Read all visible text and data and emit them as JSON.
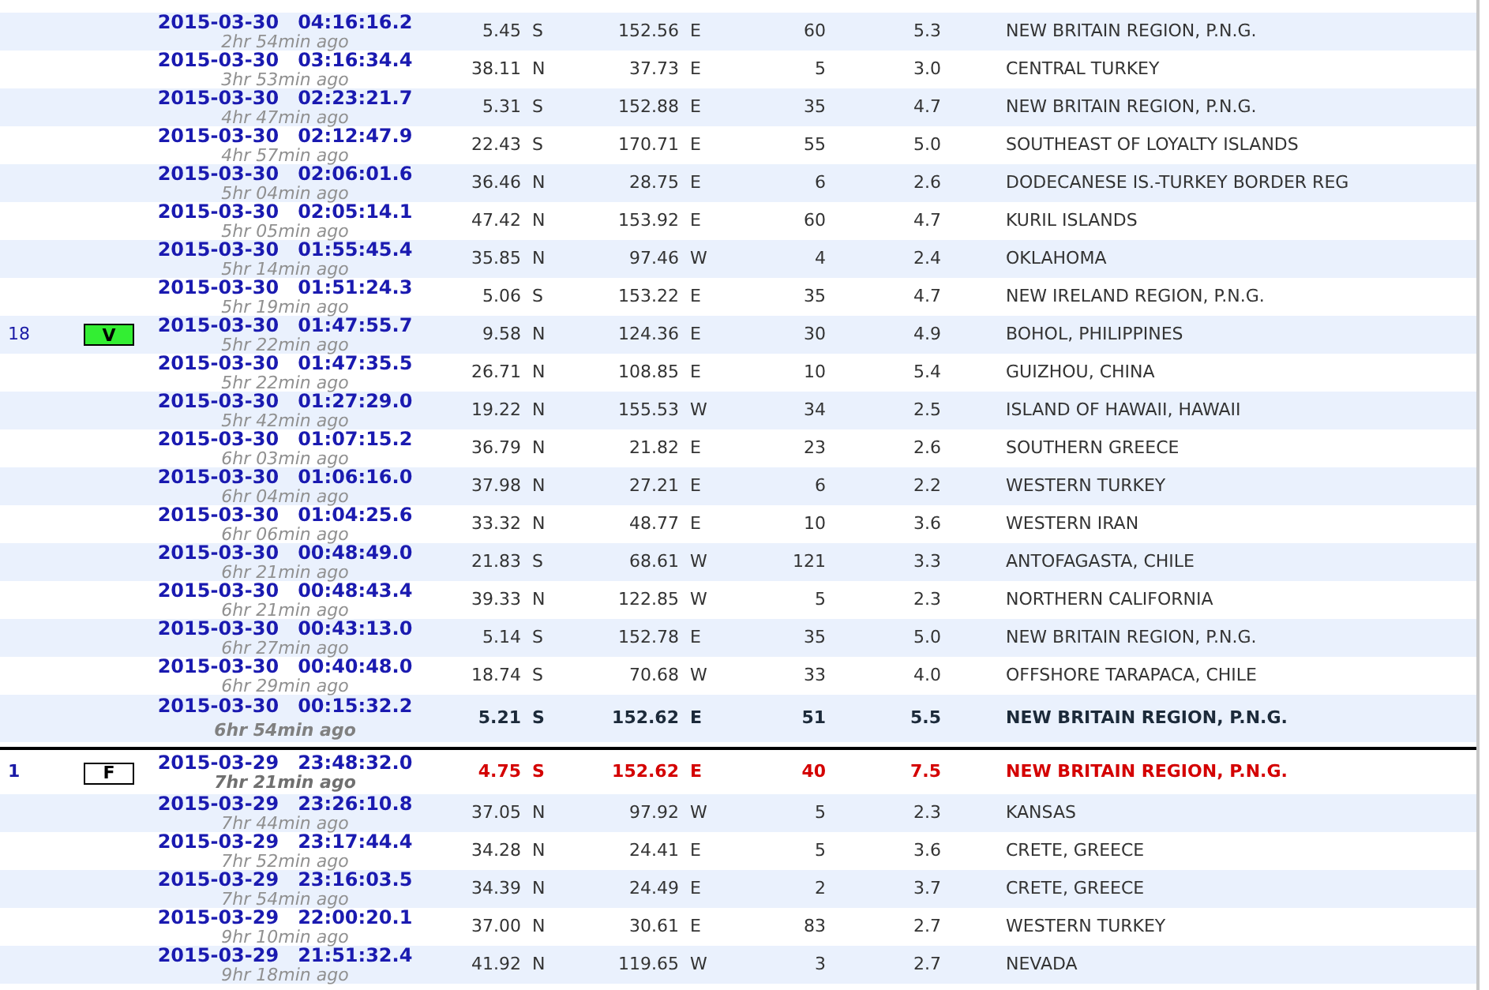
{
  "rows": [
    {
      "kind": "normal",
      "date": "2015-03-30",
      "time": "04:16:16.2",
      "ago": "2hr 54min ago",
      "lat": "5.45",
      "ns": "S",
      "lon": "152.56",
      "ew": "E",
      "depth": "60",
      "mag": "5.3",
      "location": "NEW BRITAIN REGION, P.N.G."
    },
    {
      "kind": "normal",
      "date": "2015-03-30",
      "time": "03:16:34.4",
      "ago": "3hr 53min ago",
      "lat": "38.11",
      "ns": "N",
      "lon": "37.73",
      "ew": "E",
      "depth": "5",
      "mag": "3.0",
      "location": "CENTRAL TURKEY"
    },
    {
      "kind": "normal",
      "date": "2015-03-30",
      "time": "02:23:21.7",
      "ago": "4hr 47min ago",
      "lat": "5.31",
      "ns": "S",
      "lon": "152.88",
      "ew": "E",
      "depth": "35",
      "mag": "4.7",
      "location": "NEW BRITAIN REGION, P.N.G."
    },
    {
      "kind": "normal",
      "date": "2015-03-30",
      "time": "02:12:47.9",
      "ago": "4hr 57min ago",
      "lat": "22.43",
      "ns": "S",
      "lon": "170.71",
      "ew": "E",
      "depth": "55",
      "mag": "5.0",
      "location": "SOUTHEAST OF LOYALTY ISLANDS"
    },
    {
      "kind": "normal",
      "date": "2015-03-30",
      "time": "02:06:01.6",
      "ago": "5hr 04min ago",
      "lat": "36.46",
      "ns": "N",
      "lon": "28.75",
      "ew": "E",
      "depth": "6",
      "mag": "2.6",
      "location": "DODECANESE IS.-TURKEY BORDER REG"
    },
    {
      "kind": "normal",
      "date": "2015-03-30",
      "time": "02:05:14.1",
      "ago": "5hr 05min ago",
      "lat": "47.42",
      "ns": "N",
      "lon": "153.92",
      "ew": "E",
      "depth": "60",
      "mag": "4.7",
      "location": "KURIL ISLANDS"
    },
    {
      "kind": "normal",
      "date": "2015-03-30",
      "time": "01:55:45.4",
      "ago": "5hr 14min ago",
      "lat": "35.85",
      "ns": "N",
      "lon": "97.46",
      "ew": "W",
      "depth": "4",
      "mag": "2.4",
      "location": "OKLAHOMA"
    },
    {
      "kind": "normal",
      "date": "2015-03-30",
      "time": "01:51:24.3",
      "ago": "5hr 19min ago",
      "lat": "5.06",
      "ns": "S",
      "lon": "153.22",
      "ew": "E",
      "depth": "35",
      "mag": "4.7",
      "location": "NEW IRELAND REGION, P.N.G."
    },
    {
      "kind": "normal",
      "count": "18",
      "badge": {
        "kind": "filled",
        "label": "V"
      },
      "date": "2015-03-30",
      "time": "01:47:55.7",
      "ago": "5hr 22min ago",
      "lat": "9.58",
      "ns": "N",
      "lon": "124.36",
      "ew": "E",
      "depth": "30",
      "mag": "4.9",
      "location": "BOHOL, PHILIPPINES"
    },
    {
      "kind": "normal",
      "date": "2015-03-30",
      "time": "01:47:35.5",
      "ago": "5hr 22min ago",
      "lat": "26.71",
      "ns": "N",
      "lon": "108.85",
      "ew": "E",
      "depth": "10",
      "mag": "5.4",
      "location": "GUIZHOU, CHINA"
    },
    {
      "kind": "normal",
      "date": "2015-03-30",
      "time": "01:27:29.0",
      "ago": "5hr 42min ago",
      "lat": "19.22",
      "ns": "N",
      "lon": "155.53",
      "ew": "W",
      "depth": "34",
      "mag": "2.5",
      "location": "ISLAND OF HAWAII, HAWAII"
    },
    {
      "kind": "normal",
      "date": "2015-03-30",
      "time": "01:07:15.2",
      "ago": "6hr 03min ago",
      "lat": "36.79",
      "ns": "N",
      "lon": "21.82",
      "ew": "E",
      "depth": "23",
      "mag": "2.6",
      "location": "SOUTHERN GREECE"
    },
    {
      "kind": "normal",
      "date": "2015-03-30",
      "time": "01:06:16.0",
      "ago": "6hr 04min ago",
      "lat": "37.98",
      "ns": "N",
      "lon": "27.21",
      "ew": "E",
      "depth": "6",
      "mag": "2.2",
      "location": "WESTERN TURKEY"
    },
    {
      "kind": "normal",
      "date": "2015-03-30",
      "time": "01:04:25.6",
      "ago": "6hr 06min ago",
      "lat": "33.32",
      "ns": "N",
      "lon": "48.77",
      "ew": "E",
      "depth": "10",
      "mag": "3.6",
      "location": "WESTERN IRAN"
    },
    {
      "kind": "normal",
      "date": "2015-03-30",
      "time": "00:48:49.0",
      "ago": "6hr 21min ago",
      "lat": "21.83",
      "ns": "S",
      "lon": "68.61",
      "ew": "W",
      "depth": "121",
      "mag": "3.3",
      "location": "ANTOFAGASTA, CHILE"
    },
    {
      "kind": "normal",
      "date": "2015-03-30",
      "time": "00:48:43.4",
      "ago": "6hr 21min ago",
      "lat": "39.33",
      "ns": "N",
      "lon": "122.85",
      "ew": "W",
      "depth": "5",
      "mag": "2.3",
      "location": "NORTHERN CALIFORNIA"
    },
    {
      "kind": "normal",
      "date": "2015-03-30",
      "time": "00:43:13.0",
      "ago": "6hr 27min ago",
      "lat": "5.14",
      "ns": "S",
      "lon": "152.78",
      "ew": "E",
      "depth": "35",
      "mag": "5.0",
      "location": "NEW BRITAIN REGION, P.N.G."
    },
    {
      "kind": "normal",
      "date": "2015-03-30",
      "time": "00:40:48.0",
      "ago": "6hr 29min ago",
      "lat": "18.74",
      "ns": "S",
      "lon": "70.68",
      "ew": "W",
      "depth": "33",
      "mag": "4.0",
      "location": "OFFSHORE TARAPACA, CHILE"
    },
    {
      "kind": "bold",
      "date": "2015-03-30",
      "time": "00:15:32.2",
      "ago": "6hr 54min ago",
      "lat": "5.21",
      "ns": "S",
      "lon": "152.62",
      "ew": "E",
      "depth": "51",
      "mag": "5.5",
      "location": "NEW BRITAIN REGION, P.N.G."
    },
    {
      "kind": "alert",
      "count": "1",
      "badge": {
        "kind": "outline",
        "label": "F"
      },
      "date": "2015-03-29",
      "time": "23:48:32.0",
      "ago": "7hr 21min ago",
      "lat": "4.75",
      "ns": "S",
      "lon": "152.62",
      "ew": "E",
      "depth": "40",
      "mag": "7.5",
      "location": "NEW BRITAIN REGION, P.N.G."
    },
    {
      "kind": "normal",
      "date": "2015-03-29",
      "time": "23:26:10.8",
      "ago": "7hr 44min ago",
      "lat": "37.05",
      "ns": "N",
      "lon": "97.92",
      "ew": "W",
      "depth": "5",
      "mag": "2.3",
      "location": "KANSAS"
    },
    {
      "kind": "normal",
      "date": "2015-03-29",
      "time": "23:17:44.4",
      "ago": "7hr 52min ago",
      "lat": "34.28",
      "ns": "N",
      "lon": "24.41",
      "ew": "E",
      "depth": "5",
      "mag": "3.6",
      "location": "CRETE, GREECE"
    },
    {
      "kind": "normal",
      "date": "2015-03-29",
      "time": "23:16:03.5",
      "ago": "7hr 54min ago",
      "lat": "34.39",
      "ns": "N",
      "lon": "24.49",
      "ew": "E",
      "depth": "2",
      "mag": "3.7",
      "location": "CRETE, GREECE"
    },
    {
      "kind": "normal",
      "date": "2015-03-29",
      "time": "22:00:20.1",
      "ago": "9hr 10min ago",
      "lat": "37.00",
      "ns": "N",
      "lon": "30.61",
      "ew": "E",
      "depth": "83",
      "mag": "2.7",
      "location": "WESTERN TURKEY"
    },
    {
      "kind": "normal",
      "date": "2015-03-29",
      "time": "21:51:32.4",
      "ago": "9hr 18min ago",
      "lat": "41.92",
      "ns": "N",
      "lon": "119.65",
      "ew": "W",
      "depth": "3",
      "mag": "2.7",
      "location": "NEVADA"
    }
  ]
}
